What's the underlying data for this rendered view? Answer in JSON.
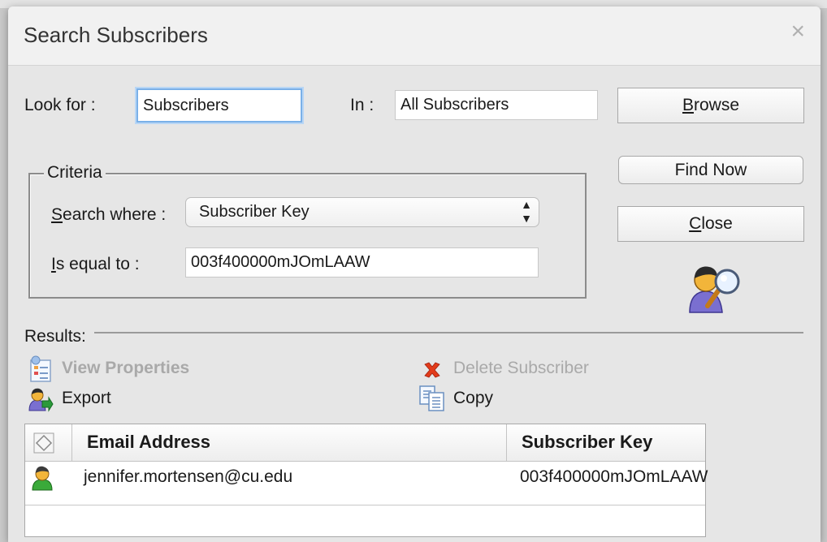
{
  "dialog": {
    "title": "Search Subscribers",
    "close_glyph": "×"
  },
  "search": {
    "look_for_label": "Look for :",
    "look_for_value": "Subscribers",
    "in_label": "In :",
    "in_value": "All Subscribers"
  },
  "buttons": {
    "browse_rest": "rowse",
    "browse_mnemonic": "B",
    "find_now": "Find Now",
    "close_rest": "lose",
    "close_mnemonic": "C"
  },
  "criteria": {
    "legend": "Criteria",
    "search_where_mnemonic": "S",
    "search_where_rest": "earch where :",
    "search_where_value": "Subscriber Key",
    "is_equal_mnemonic": "I",
    "is_equal_rest": "s equal to :",
    "is_equal_value": "003f400000mJOmLAAW"
  },
  "results": {
    "label": "Results:",
    "actions": {
      "view_properties": "View Properties",
      "delete_subscriber": "Delete Subscriber",
      "export": "Export",
      "copy": "Copy"
    },
    "columns": [
      "Email Address",
      "Subscriber Key"
    ],
    "rows": [
      {
        "email": "jennifer.mortensen@cu.edu",
        "key": "003f400000mJOmLAAW"
      }
    ]
  },
  "icons": {
    "search_person": "search-person-icon",
    "view_properties": "properties-icon",
    "delete": "delete-x-icon",
    "export": "export-icon",
    "copy": "copy-icon",
    "select_all": "select-all-icon",
    "subscriber": "subscriber-person-icon"
  },
  "colors": {
    "focus_ring": "#7ab0e8",
    "delete_red": "#e23b1a",
    "disabled_text": "#a9a9a9"
  }
}
